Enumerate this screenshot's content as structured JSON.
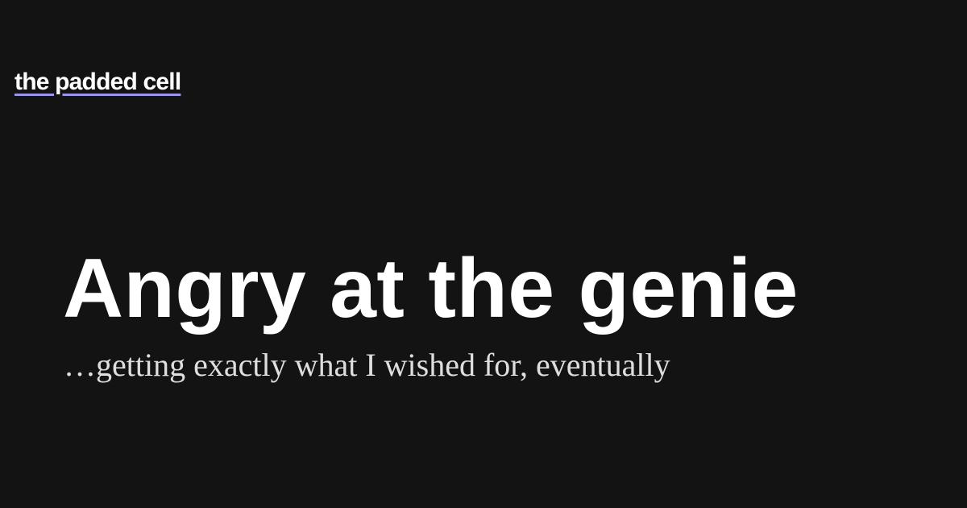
{
  "site": {
    "name": "the padded cell"
  },
  "post": {
    "title": "Angry at the genie",
    "subtitle": "…getting exactly what I wished for, eventually"
  },
  "colors": {
    "background": "#131313",
    "text": "#ffffff",
    "subtitle_text": "#dedede",
    "link_underline": "#9b95e6"
  }
}
